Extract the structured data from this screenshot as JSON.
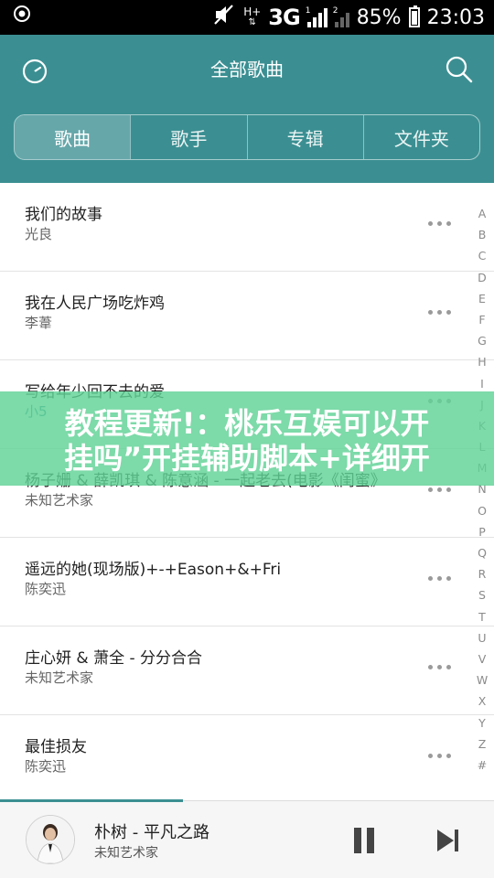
{
  "status_bar": {
    "network_type": "3G",
    "network_sub_h": "H+",
    "signal_sub": "1",
    "sim2_sub": "2",
    "battery": "85%",
    "time": "23:03"
  },
  "header": {
    "title": "全部歌曲",
    "tabs": [
      "歌曲",
      "歌手",
      "专辑",
      "文件夹"
    ],
    "accent": "#3b8f92"
  },
  "songs": [
    {
      "title": "我们的故事",
      "artist": "光良"
    },
    {
      "title": "我在人民广场吃炸鸡",
      "artist": "李葦"
    },
    {
      "title": "写给年少回不去的爱",
      "artist": "小5"
    },
    {
      "title": "杨子姗 & 薛凯琪 & 陈意涵 - 一起老去(电影《闺蜜》",
      "artist": "未知艺术家"
    },
    {
      "title": "遥远的她(现场版)+-+Eason+&+Fri",
      "artist": "陈奕迅"
    },
    {
      "title": "庄心妍 & 萧全 - 分分合合",
      "artist": "未知艺术家"
    },
    {
      "title": "最佳损友",
      "artist": "陈奕迅"
    }
  ],
  "alphabet": [
    "A",
    "B",
    "C",
    "D",
    "E",
    "F",
    "G",
    "H",
    "I",
    "J",
    "K",
    "L",
    "M",
    "N",
    "O",
    "P",
    "Q",
    "R",
    "S",
    "T",
    "U",
    "V",
    "W",
    "X",
    "Y",
    "Z",
    "#"
  ],
  "banner": {
    "line1": "教程更新!：桃乐互娱可以开",
    "line2": "挂吗”开挂辅助脚本+详细开",
    "color": "#60d296"
  },
  "player": {
    "title": "朴树 - 平凡之路",
    "artist": "未知艺术家",
    "progress": 0.37
  }
}
